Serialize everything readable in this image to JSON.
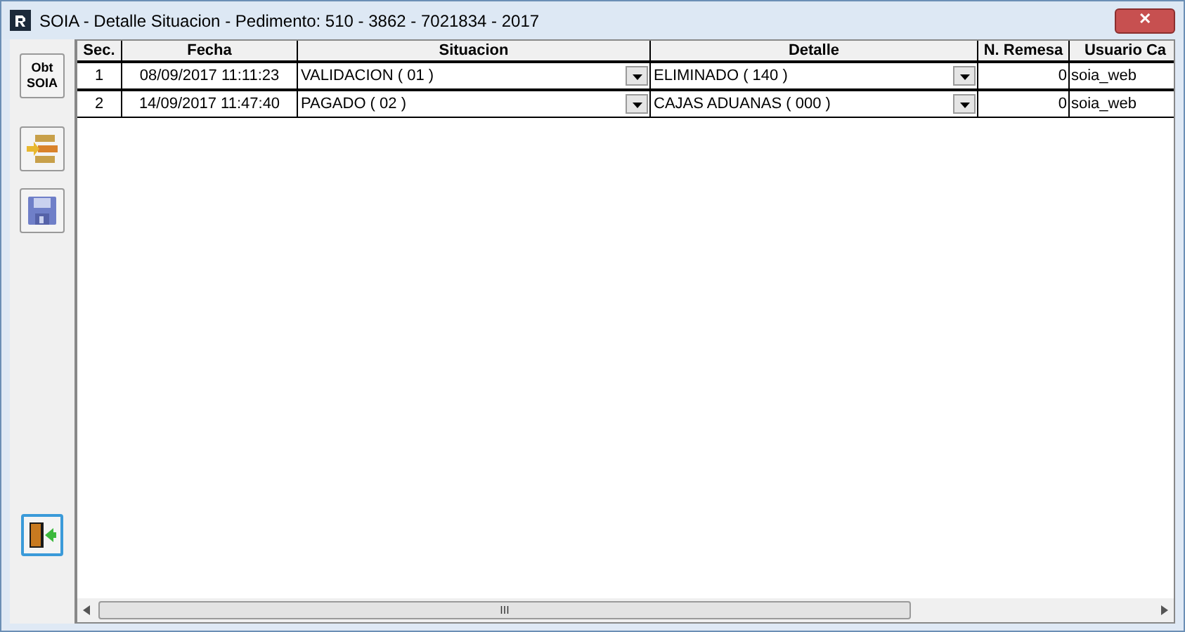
{
  "window": {
    "title": "SOIA - Detalle Situacion - Pedimento: 510 - 3862 - 7021834 - 2017",
    "close_symbol": "✕"
  },
  "toolbar": {
    "obt_button": "Obt SOIA"
  },
  "table": {
    "columns": [
      {
        "label": "Sec.",
        "kind": "center"
      },
      {
        "label": "Fecha",
        "kind": "center"
      },
      {
        "label": "Situacion",
        "kind": "combo"
      },
      {
        "label": "Detalle",
        "kind": "combo"
      },
      {
        "label": "N. Remesa",
        "kind": "number"
      },
      {
        "label": "Usuario Ca",
        "kind": "text"
      }
    ],
    "rows": [
      [
        "1",
        "08/09/2017 11:11:23",
        "VALIDACION ( 01 )",
        "ELIMINADO ( 140 )",
        "0",
        "soia_web"
      ],
      [
        "2",
        "14/09/2017 11:47:40",
        "PAGADO ( 02 )",
        "CAJAS ADUANAS ( 000 )",
        "0",
        "soia_web"
      ]
    ]
  },
  "scrollbar": {
    "grip": "III"
  }
}
